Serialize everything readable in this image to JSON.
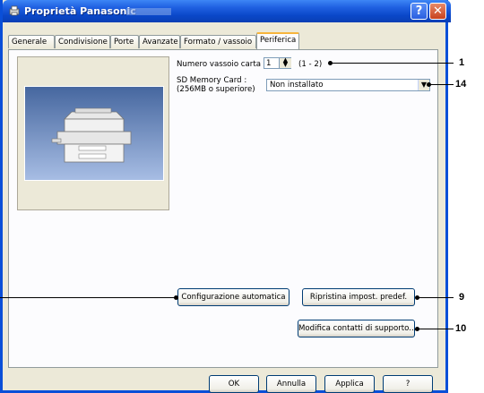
{
  "window": {
    "title": "Proprietà Panasonic"
  },
  "title_buttons": {
    "help": "?",
    "close": "✕"
  },
  "tabs": [
    {
      "label": "Generale"
    },
    {
      "label": "Condivisione"
    },
    {
      "label": "Porte"
    },
    {
      "label": "Avanzate"
    },
    {
      "label": "Formato / vassoio"
    },
    {
      "label": "Periferica",
      "active": true
    }
  ],
  "settings": {
    "tray_number_label": "Numero vassoio carta :",
    "tray_number_value": "1",
    "tray_range": "(1 - 2)",
    "sd_card_label_line1": "SD Memory Card :",
    "sd_card_label_line2": "(256MB o superiore)",
    "sd_card_value": "Non installato"
  },
  "buttons": {
    "auto_config": "Configurazione automatica",
    "restore_defaults": "Ripristina impost. predef.",
    "modify_contacts": "Modifica contatti di supporto...",
    "ok": "OK",
    "cancel": "Annulla",
    "apply": "Applica",
    "help": "?"
  },
  "callouts": {
    "tray": "1",
    "sd": "14",
    "restore": "9",
    "modify": "10"
  },
  "colors": {
    "titlebar": "#0a47c8",
    "dialog_bg": "#ece9d8",
    "active_tab_accent": "#f7b53c"
  }
}
